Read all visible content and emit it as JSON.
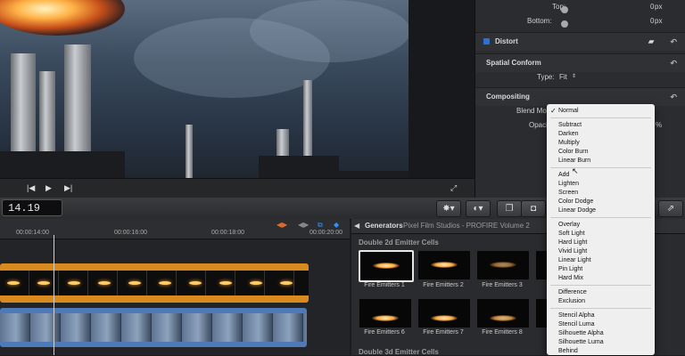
{
  "inspector": {
    "top_label": "Top:",
    "top_value": "0",
    "top_unit": "px",
    "bottom_label": "Bottom:",
    "bottom_value": "0",
    "bottom_unit": "px",
    "distort_label": "Distort",
    "spatial_label": "Spatial Conform",
    "type_label": "Type:",
    "type_value": "Fit",
    "compositing_label": "Compositing",
    "blend_label": "Blend Mod",
    "opacity_label": "Opaci",
    "opacity_value": "%"
  },
  "toolbar": {
    "timecode": "14.19"
  },
  "timeline": {
    "ruler": [
      "00:00:14:00",
      "00:00:16:00",
      "00:00:18:00",
      "00:00:20:00"
    ]
  },
  "generators": {
    "title": "Generators",
    "path": "Pixel Film Studios - PROFIRE Volume 2",
    "section1": "Double 2d Emitter Cells",
    "section2": "Double 3d Emitter Cells",
    "row1": [
      "Fire Emitters 1",
      "Fire Emitters 2",
      "Fire Emitters 3"
    ],
    "row2": [
      "Fire Emitters 6",
      "Fire Emitters 7",
      "Fire Emitters 8"
    ]
  },
  "blend_menu": {
    "checkmark": "✓",
    "group1": [
      "Normal"
    ],
    "group2": [
      "Subtract",
      "Darken",
      "Multiply",
      "Color Burn",
      "Linear Burn"
    ],
    "group3": [
      "Add",
      "Lighten",
      "Screen",
      "Color Dodge",
      "Linear Dodge"
    ],
    "group4": [
      "Overlay",
      "Soft Light",
      "Hard Light",
      "Vivid Light",
      "Linear Light",
      "Pin Light",
      "Hard Mix"
    ],
    "group5": [
      "Difference",
      "Exclusion"
    ],
    "group6": [
      "Stencil Alpha",
      "Stencil Luma",
      "Silhouette Alpha",
      "Silhouette Luma",
      "Behind"
    ]
  },
  "colors": {
    "clip_audio": "#d88a1f",
    "clip_video": "#4d79b8",
    "accent": "#2f6fd6"
  }
}
